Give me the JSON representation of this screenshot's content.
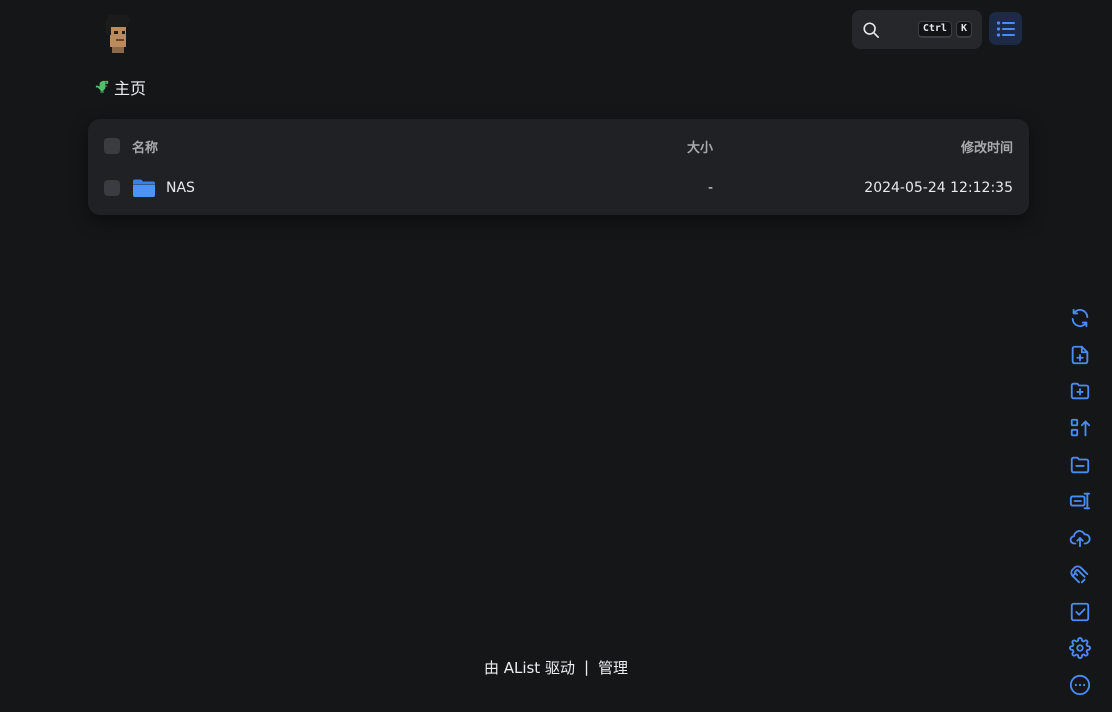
{
  "header": {
    "avatar_icon": "pixel-avatar-icon",
    "search": {
      "icon": "search-icon",
      "shortcut_keys": [
        "Ctrl",
        "K"
      ]
    },
    "layout_toggle_icon": "list-layout-icon",
    "accent_color": "#4a8cf7"
  },
  "breadcrumb": {
    "icon": "dinosaur-icon",
    "home_label": "主页"
  },
  "file_table": {
    "columns": {
      "name": "名称",
      "size": "大小",
      "modified": "修改时间"
    },
    "rows": [
      {
        "icon": "folder-icon",
        "name": "NAS",
        "size": "-",
        "modified": "2024-05-24 12:12:35"
      }
    ]
  },
  "toolbar": {
    "items": [
      "refresh-icon",
      "new-file-icon",
      "new-folder-icon",
      "sort-icon",
      "folder-minus-icon",
      "offline-download-icon",
      "upload-icon",
      "magnet-icon",
      "check-square-icon",
      "settings-icon",
      "more-icon"
    ]
  },
  "footer": {
    "powered_by": "由 AList 驱动",
    "separator": "|",
    "manage_label": "管理"
  }
}
